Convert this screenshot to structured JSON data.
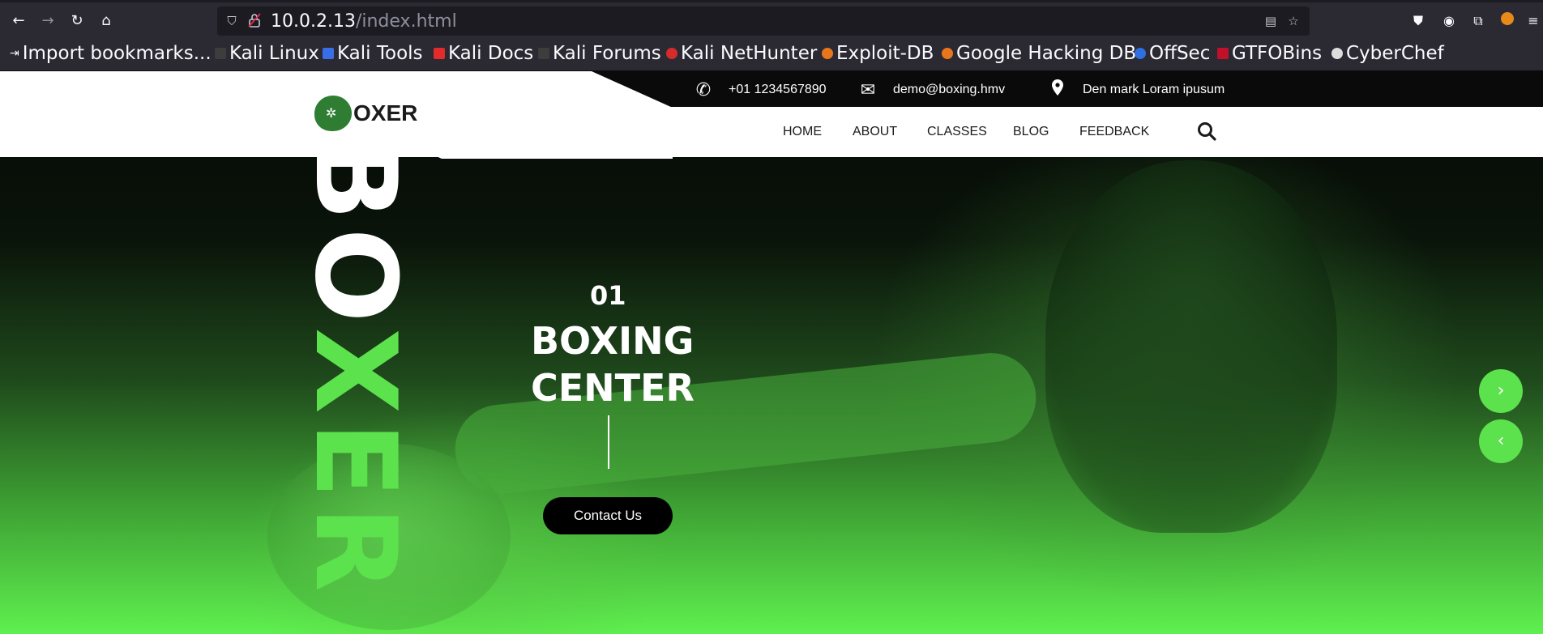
{
  "browser": {
    "url_host": "10.0.2.13",
    "url_path": "/index.html",
    "icons": [
      "back-icon",
      "forward-icon",
      "reload-icon",
      "home-icon",
      "shield-icon",
      "insecure-lock-icon",
      "reader-mode-icon",
      "bookmark-star-icon",
      "pocket-icon",
      "account-icon",
      "extensions-icon",
      "extension-fox-icon",
      "menu-icon"
    ],
    "bookmarks": [
      {
        "label": "Import bookmarks...",
        "color": "#fbfbfe"
      },
      {
        "label": "Kali Linux",
        "color": "#3d3d3d"
      },
      {
        "label": "Kali Tools",
        "color": "#3a6ee8"
      },
      {
        "label": "Kali Docs",
        "color": "#e22b2b"
      },
      {
        "label": "Kali Forums",
        "color": "#3d3d3d"
      },
      {
        "label": "Kali NetHunter",
        "color": "#d62b2b"
      },
      {
        "label": "Exploit-DB",
        "color": "#e8761b"
      },
      {
        "label": "Google Hacking DB",
        "color": "#e8761b"
      },
      {
        "label": "OffSec",
        "color": "#2f6fe0"
      },
      {
        "label": "GTFOBins",
        "color": "#c0102a"
      },
      {
        "label": "CyberChef",
        "color": "#dddddd"
      }
    ]
  },
  "site": {
    "contact": {
      "phone": "+01 1234567890",
      "email": "demo@boxing.hmv",
      "address": "Den mark Loram ipusum"
    },
    "logo_text": "OXER",
    "menu": [
      "HOME",
      "ABOUT",
      "CLASSES",
      "BLOG",
      "FEEDBACK"
    ],
    "vertical_word": [
      "B",
      "O",
      "X",
      "E",
      "R"
    ],
    "vertical_colors": [
      "#ffffff",
      "#ffffff",
      "#5ce24c",
      "#5ce24c",
      "#5ce24c"
    ],
    "slide": {
      "number": "01",
      "title_line1": "BOXING",
      "title_line2": "CENTER",
      "button": "Contact Us"
    },
    "accent_color": "#5ce24c",
    "carousel": {
      "next_glyph": "›",
      "prev_glyph": "‹"
    }
  }
}
